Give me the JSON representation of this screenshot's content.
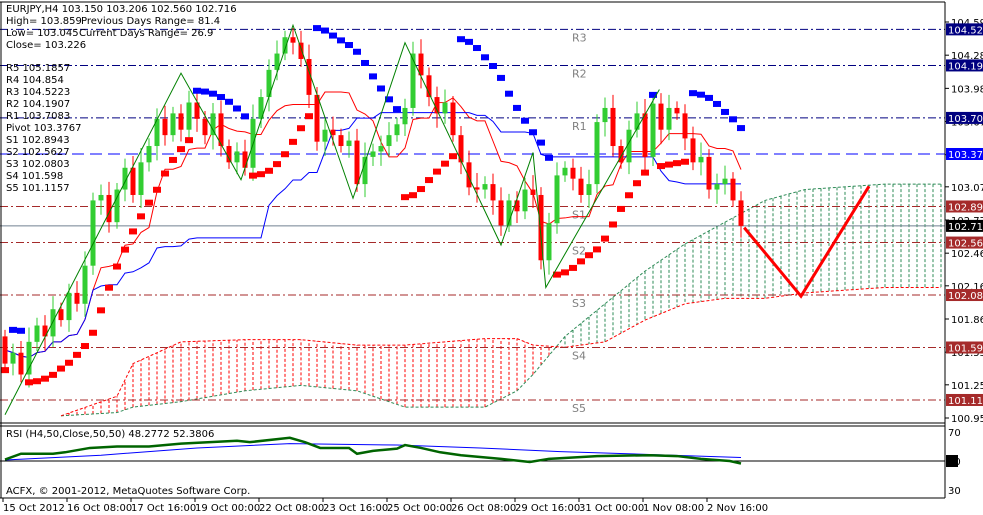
{
  "header": {
    "symbol_line": "EURJPY,H4  103.150 103.206 102.560 102.716",
    "high": "High= 103.859",
    "prev_range": "Previous Days Range= 81.4",
    "low": "Low= 103.045",
    "cur_range": "Current Days Range= 26.9",
    "close": "Close= 103.226"
  },
  "pivot_table": [
    "R5 105.1857",
    "R4 104.854",
    "R3 104.5223",
    "R2 104.1907",
    "R1 103.7083",
    "Pivot 103.3767",
    "S1 102.8943",
    "S2 102.5627",
    "S3 102.0803",
    "S4 101.598",
    "S5 101.1157"
  ],
  "rsi_label": "RSI (H4,50,Close,50,50) 48.2772 52.3806",
  "copyright": "ACFX, © 2001-2012, MetaQuotes Software Corp.",
  "colors": {
    "bull": "#32cd32",
    "bear": "#ff0000",
    "sar_up": "#ff0000",
    "sar_down": "#0000ff",
    "resistance": "#000080",
    "pivot": "#0000ff",
    "support": "#a52a2a",
    "zigzag": "#008000",
    "cloud_bull": "#2e8b57",
    "cloud_bear": "#ff0000"
  },
  "chart_data": {
    "type": "candlestick",
    "symbol": "EURJPY",
    "timeframe": "H4",
    "ylim": [
      100.95,
      104.59
    ],
    "y_ticks": [
      "104.590",
      "104.285",
      "103.980",
      "103.675",
      "103.370",
      "103.075",
      "102.770",
      "102.465",
      "102.165",
      "101.860",
      "101.555",
      "101.255",
      "100.950"
    ],
    "x_ticks": [
      "15 Oct 2012",
      "16 Oct 08:00",
      "17 Oct 16:00",
      "19 Oct 00:00",
      "22 Oct 08:00",
      "23 Oct 16:00",
      "25 Oct 00:00",
      "26 Oct 08:00",
      "29 Oct 16:00",
      "31 Oct 00:00",
      "1 Nov 08:00",
      "2 Nov 16:00"
    ],
    "bars_per_x_tick": 8,
    "first_open": 101.7,
    "closes": [
      101.45,
      101.55,
      101.35,
      101.65,
      101.8,
      101.7,
      101.95,
      101.85,
      102.1,
      102.0,
      102.35,
      102.95,
      103.0,
      102.75,
      103.05,
      103.25,
      103.0,
      103.3,
      103.45,
      103.7,
      103.55,
      103.75,
      103.6,
      103.85,
      103.7,
      103.55,
      103.75,
      103.45,
      103.3,
      103.4,
      103.25,
      103.7,
      103.9,
      104.15,
      104.3,
      104.45,
      104.4,
      104.25,
      103.92,
      103.49,
      103.6,
      103.55,
      103.45,
      103.5,
      103.1,
      103.35,
      103.4,
      103.45,
      103.55,
      103.65,
      103.8,
      104.3,
      104.1,
      103.9,
      103.75,
      103.85,
      103.55,
      103.3,
      103.07,
      103.05,
      103.1,
      102.95,
      102.72,
      102.95,
      102.85,
      103.05,
      103.0,
      102.4,
      102.74,
      103.18,
      103.25,
      103.15,
      103.0,
      103.1,
      103.67,
      103.8,
      103.45,
      103.3,
      103.6,
      103.75,
      103.35,
      103.84,
      103.6,
      103.8,
      103.75,
      103.52,
      103.3,
      103.35,
      103.05,
      103.1,
      103.15,
      102.95,
      102.716
    ],
    "pivot_levels": [
      {
        "name": "R3",
        "value": 104.5223,
        "label": "104.522",
        "kind": "resistance"
      },
      {
        "name": "R2",
        "value": 104.1907,
        "label": "104.191",
        "kind": "resistance"
      },
      {
        "name": "R1",
        "value": 103.7083,
        "label": "103.708",
        "kind": "resistance"
      },
      {
        "name": "Pivot",
        "value": 103.3767,
        "label": "103.377",
        "kind": "pivot"
      },
      {
        "name": "S1",
        "value": 102.8943,
        "label": "102.894",
        "kind": "support"
      },
      {
        "name": "S2",
        "value": 102.5627,
        "label": "102.563",
        "kind": "support"
      },
      {
        "name": "S3",
        "value": 102.0803,
        "label": "102.080",
        "kind": "support"
      },
      {
        "name": "S4",
        "value": 101.598,
        "label": "101.598",
        "kind": "support"
      },
      {
        "name": "S5",
        "value": 101.1157,
        "label": "101.116",
        "kind": "support"
      }
    ],
    "current_price": {
      "value": 102.716,
      "label": "102.716"
    },
    "zigzag": [
      [
        0,
        100.98
      ],
      [
        22,
        104.12
      ],
      [
        29.5,
        103.14
      ],
      [
        36,
        104.56
      ],
      [
        43.5,
        102.97
      ],
      [
        50,
        104.4
      ],
      [
        62,
        102.54
      ],
      [
        66,
        103.39
      ],
      [
        67.6,
        102.15
      ],
      [
        81.8,
        103.97
      ]
    ],
    "projection": [
      [
        92.4,
        102.7
      ],
      [
        99.5,
        102.07
      ],
      [
        108,
        103.08
      ]
    ],
    "cloud": [
      [
        7,
        100.97,
        100.97
      ],
      [
        14,
        101.0,
        101.15
      ],
      [
        16,
        101.05,
        101.45
      ],
      [
        22,
        101.1,
        101.65
      ],
      [
        30,
        101.2,
        101.67
      ],
      [
        37,
        101.25,
        101.67
      ],
      [
        44,
        101.2,
        101.62
      ],
      [
        50,
        101.05,
        101.62
      ],
      [
        60,
        101.05,
        101.68
      ],
      [
        64,
        101.2,
        101.68
      ],
      [
        66,
        101.35,
        101.62
      ],
      [
        70,
        101.7,
        101.6
      ],
      [
        75,
        102.0,
        101.65
      ],
      [
        80,
        102.3,
        101.85
      ],
      [
        85,
        102.55,
        102.0
      ],
      [
        90,
        102.75,
        102.05
      ],
      [
        95,
        102.95,
        102.05
      ],
      [
        100,
        103.05,
        102.1
      ],
      [
        110,
        103.1,
        102.15
      ],
      [
        117,
        103.1,
        102.15
      ]
    ],
    "rsi": {
      "levels": [
        70,
        50,
        30
      ],
      "ylim": [
        25,
        75
      ],
      "rsi_line": [
        [
          0,
          51
        ],
        [
          2,
          55
        ],
        [
          6,
          55
        ],
        [
          7.5,
          56
        ],
        [
          10.6,
          59
        ],
        [
          14,
          60
        ],
        [
          18,
          60
        ],
        [
          22,
          62
        ],
        [
          29,
          64
        ],
        [
          30.6,
          63
        ],
        [
          35.6,
          66
        ],
        [
          37.5,
          63
        ],
        [
          39.4,
          59
        ],
        [
          43,
          59
        ],
        [
          44,
          55
        ],
        [
          46,
          57
        ],
        [
          49,
          58.5
        ],
        [
          50,
          61
        ],
        [
          52,
          59
        ],
        [
          54.4,
          56
        ],
        [
          57,
          54
        ],
        [
          62,
          51.5
        ],
        [
          65.6,
          49.3
        ],
        [
          68,
          51.5
        ],
        [
          74,
          53.4
        ],
        [
          80.6,
          54
        ],
        [
          84,
          53.4
        ],
        [
          87,
          51.5
        ],
        [
          90.6,
          50
        ],
        [
          92,
          48.28
        ]
      ],
      "signal_line": [
        [
          0,
          50.7
        ],
        [
          12,
          54
        ],
        [
          24,
          59
        ],
        [
          35.6,
          62
        ],
        [
          49,
          61
        ],
        [
          59.4,
          59
        ],
        [
          69.4,
          56.5
        ],
        [
          80.6,
          54.5
        ],
        [
          92,
          52.38
        ]
      ]
    }
  }
}
